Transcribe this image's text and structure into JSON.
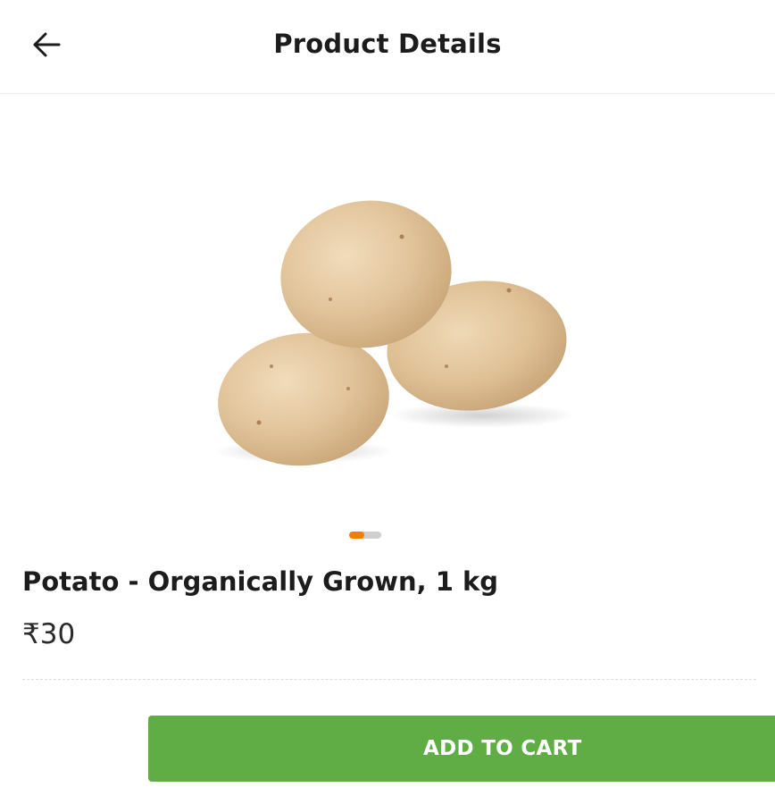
{
  "header": {
    "back_icon": "arrow-left-icon",
    "title": "Product Details"
  },
  "gallery": {
    "image_subject": "potatoes-image",
    "pager": {
      "current": 1,
      "total": 2,
      "active_color": "#f57c00",
      "inactive_color": "#cfcfcf"
    }
  },
  "product": {
    "name": "Potato - Organically Grown, 1 kg",
    "price": "₹30"
  },
  "actions": {
    "add_to_cart_label": "ADD TO CART",
    "button_color": "#61ad45"
  }
}
